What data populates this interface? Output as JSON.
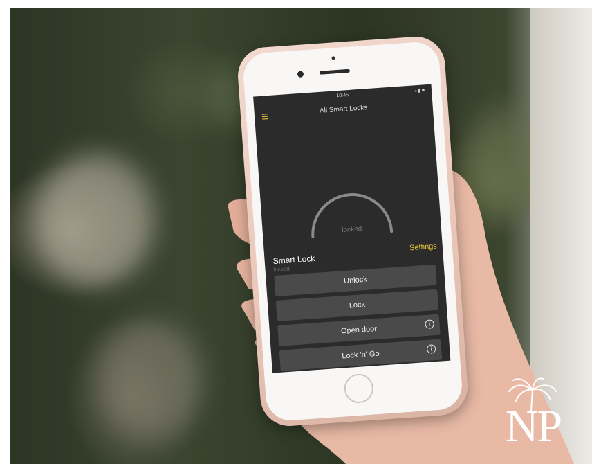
{
  "phone": {
    "status_time": "10:45",
    "status_icons": "◂ ▮ ■",
    "header_title": "All Smart Locks",
    "gauge_label": "locked",
    "lock_name": "Smart Lock",
    "lock_status": "locked",
    "settings_label": "Settings",
    "buttons": [
      {
        "label": "Unlock",
        "has_info": false
      },
      {
        "label": "Lock",
        "has_info": false
      },
      {
        "label": "Open door",
        "has_info": true
      },
      {
        "label": "Lock 'n' Go",
        "has_info": true
      }
    ],
    "info_symbol": "i"
  },
  "logo": {
    "text": "NP"
  },
  "colors": {
    "accent": "#e6c33c",
    "screen_bg": "#2b2b2b",
    "button_bg": "#4a4a4a",
    "phone_shell": "#e9c6b8"
  }
}
